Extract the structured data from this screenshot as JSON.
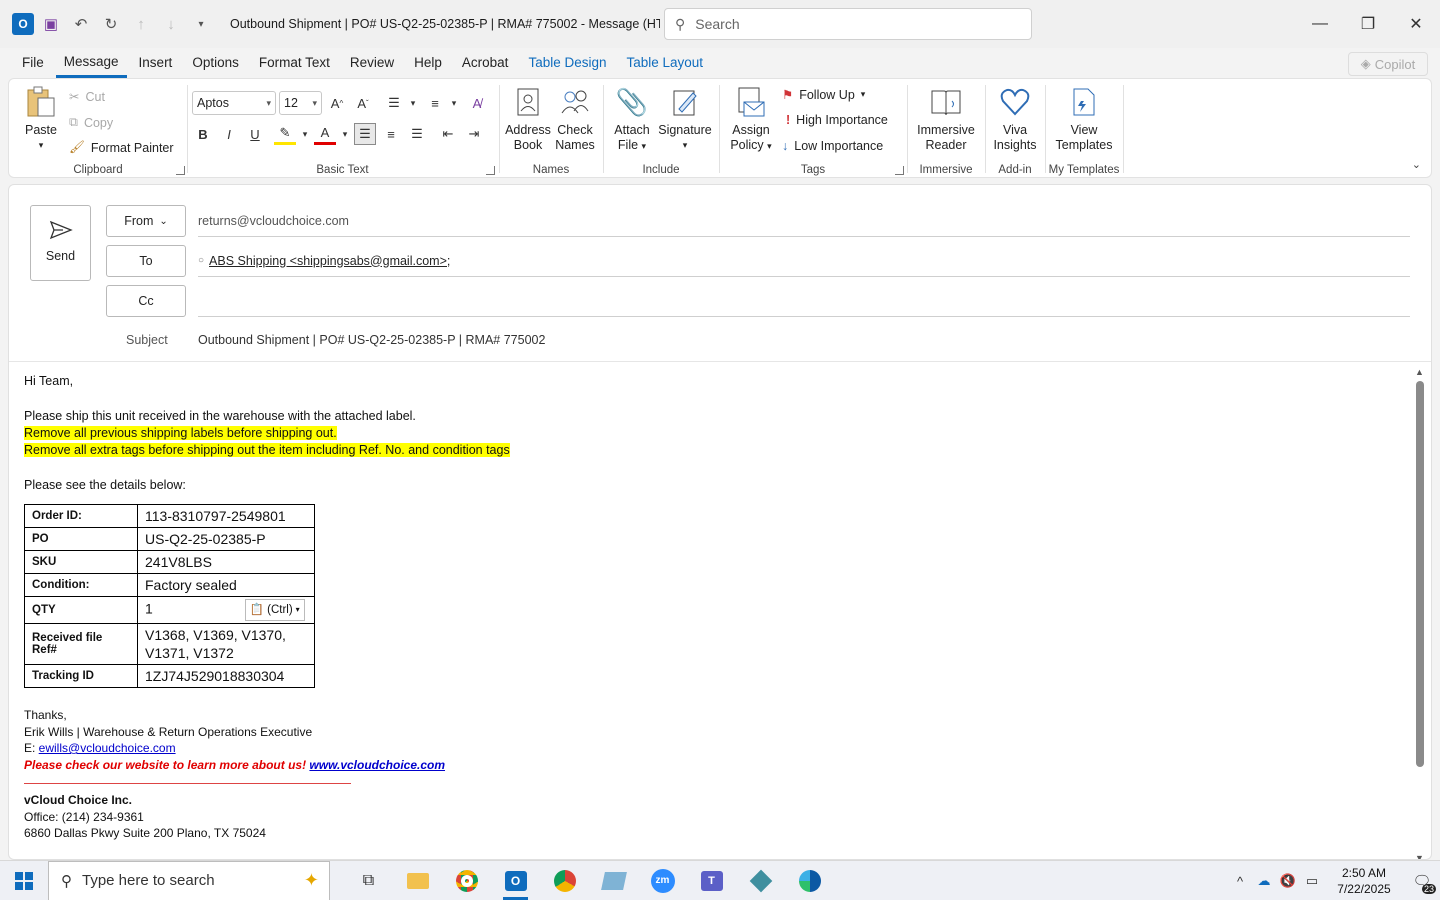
{
  "window": {
    "title": "Outbound Shipment | PO# US-Q2-25-02385-P | RMA# 775002  -  Message (HT...",
    "search_placeholder": "Search"
  },
  "menu": {
    "tabs": [
      "File",
      "Message",
      "Insert",
      "Options",
      "Format Text",
      "Review",
      "Help",
      "Acrobat",
      "Table Design",
      "Table Layout"
    ],
    "active": "Message",
    "copilot": "Copilot"
  },
  "ribbon": {
    "clipboard": {
      "label": "Clipboard",
      "paste": "Paste",
      "cut": "Cut",
      "copy": "Copy",
      "format_painter": "Format Painter"
    },
    "basic_text": {
      "label": "Basic Text",
      "font": "Aptos",
      "size": "12"
    },
    "names": {
      "label": "Names",
      "address_book_1": "Address",
      "address_book_2": "Book",
      "check_names_1": "Check",
      "check_names_2": "Names"
    },
    "include": {
      "label": "Include",
      "attach_1": "Attach",
      "attach_2": "File",
      "signature": "Signature"
    },
    "tags": {
      "label": "Tags",
      "assign_1": "Assign",
      "assign_2": "Policy",
      "follow_up": "Follow Up",
      "high": "High Importance",
      "low": "Low Importance"
    },
    "immersive": {
      "label": "Immersive",
      "btn_1": "Immersive",
      "btn_2": "Reader"
    },
    "addin": {
      "label": "Add-in",
      "btn_1": "Viva",
      "btn_2": "Insights"
    },
    "templates": {
      "label": "My Templates",
      "btn_1": "View",
      "btn_2": "Templates"
    }
  },
  "compose": {
    "send": "Send",
    "from_label": "From",
    "from_value": "returns@vcloudchoice.com",
    "to_label": "To",
    "to_value": "ABS Shipping <shippingsabs@gmail.com>;",
    "cc_label": "Cc",
    "subject_label": "Subject",
    "subject_value": "Outbound Shipment | PO# US-Q2-25-02385-P | RMA# 775002"
  },
  "body": {
    "greeting": "Hi Team,",
    "line1": "Please ship this unit received in the warehouse with the attached label.",
    "hl1": "Remove all previous shipping labels before shipping out.",
    "hl2": "Remove all extra tags before shipping out the item including Ref. No. and condition tags",
    "details_intro": "Please see the details below:",
    "table": [
      {
        "k": "Order ID:",
        "v": "113-8310797-2549801"
      },
      {
        "k": "PO",
        "v": "US-Q2-25-02385-P"
      },
      {
        "k": "SKU",
        "v": "241V8LBS"
      },
      {
        "k": "Condition:",
        "v": "Factory sealed"
      },
      {
        "k": "QTY",
        "v": "1"
      },
      {
        "k": "Received file Ref#",
        "v": "V1368, V1369, V1370, V1371, V1372"
      },
      {
        "k": "Tracking ID",
        "v": "1ZJ74J529018830304"
      }
    ],
    "paste_options": "(Ctrl)",
    "thanks": "Thanks,",
    "sig_name": "Erik Wills | Warehouse & Return Operations Executive",
    "sig_email_prefix": "E: ",
    "sig_email": "ewills@vcloudchoice.com",
    "sig_promo": "Please check our website to learn more about us! ",
    "sig_site": "www.vcloudchoice.com",
    "company": "vCloud Choice Inc.",
    "office": "Office: (214) 234-9361",
    "address": "6860 Dallas Pkwy Suite 200 Plano, TX 75024"
  },
  "taskbar": {
    "search_placeholder": "Type here to search",
    "time": "2:50 AM",
    "date": "7/22/2025",
    "notifications": "23"
  }
}
